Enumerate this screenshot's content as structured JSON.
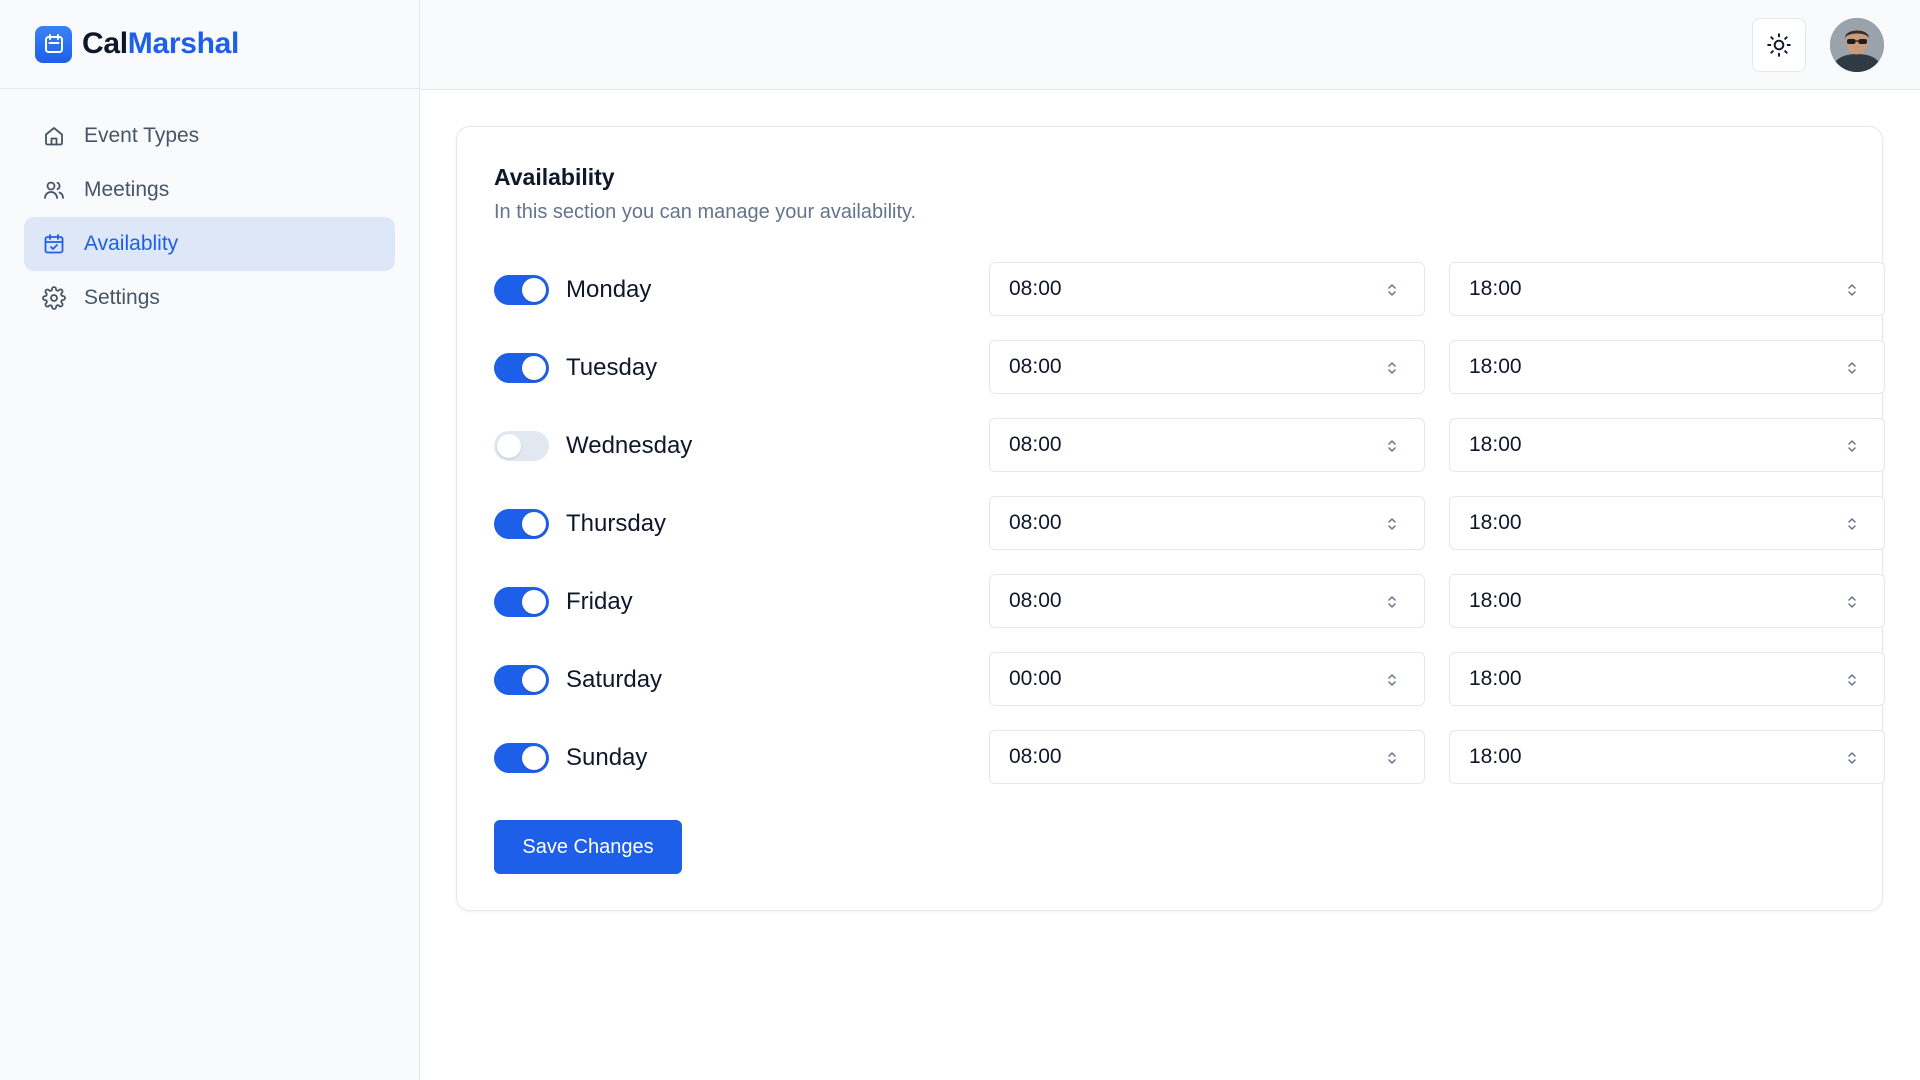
{
  "brand": {
    "name_part1": "Cal",
    "name_part2": "Marshal",
    "logo_icon": "calendar-icon"
  },
  "sidebar": {
    "items": [
      {
        "label": "Event Types",
        "icon": "home-icon",
        "active": false
      },
      {
        "label": "Meetings",
        "icon": "users-icon",
        "active": false
      },
      {
        "label": "Availablity",
        "icon": "calendar-check-icon",
        "active": true
      },
      {
        "label": "Settings",
        "icon": "gear-icon",
        "active": false
      }
    ]
  },
  "header": {
    "theme_icon": "sun-icon",
    "avatar_icon": "user-avatar"
  },
  "availability": {
    "title": "Availability",
    "subtitle": "In this section you can manage your availability.",
    "days": [
      {
        "day": "Monday",
        "enabled": true,
        "start": "08:00",
        "end": "18:00"
      },
      {
        "day": "Tuesday",
        "enabled": true,
        "start": "08:00",
        "end": "18:00"
      },
      {
        "day": "Wednesday",
        "enabled": false,
        "start": "08:00",
        "end": "18:00"
      },
      {
        "day": "Thursday",
        "enabled": true,
        "start": "08:00",
        "end": "18:00"
      },
      {
        "day": "Friday",
        "enabled": true,
        "start": "08:00",
        "end": "18:00"
      },
      {
        "day": "Saturday",
        "enabled": true,
        "start": "00:00",
        "end": "18:00"
      },
      {
        "day": "Sunday",
        "enabled": true,
        "start": "08:00",
        "end": "18:00"
      }
    ],
    "save_label": "Save Changes"
  },
  "colors": {
    "accent": "#1d5fe8",
    "toggle_off": "#e2e8f0",
    "sidebar_active_bg": "#dde7f7"
  }
}
